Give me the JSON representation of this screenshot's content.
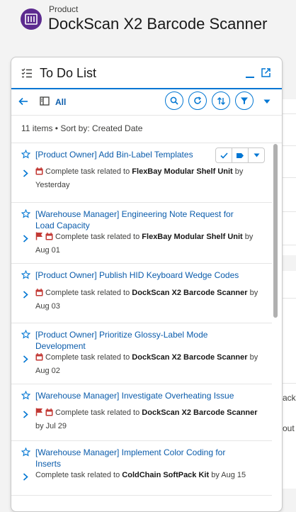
{
  "header": {
    "object_label": "Product",
    "record_title": "DockScan X2 Barcode Scanner"
  },
  "background": {
    "snippets": [
      "ack,",
      "out"
    ]
  },
  "panel": {
    "title": "To Do List",
    "list_view": "All",
    "count_sort": "11 items • Sort by: Created Date"
  },
  "tasks": [
    {
      "title": "[Product Owner] Add Bin-Label Templates",
      "prefix": "Complete task related to ",
      "related": "FlexBay Modular Shelf Unit",
      "due": " by Yesterday",
      "icons": [
        "calendar"
      ]
    },
    {
      "title": "[Warehouse Manager] Engineering Note Request for Load Capacity",
      "prefix": "Complete task related to ",
      "related": "FlexBay Modular Shelf Unit",
      "due": " by Aug 01",
      "icons": [
        "flag",
        "calendar"
      ]
    },
    {
      "title": "[Product Owner] Publish HID Keyboard Wedge Codes",
      "prefix": "Complete task related to ",
      "related": "DockScan X2 Barcode Scanner",
      "due": " by Aug 03",
      "icons": [
        "calendar"
      ]
    },
    {
      "title": "[Product Owner] Prioritize Glossy-Label Mode Development",
      "prefix": "Complete task related to ",
      "related": "DockScan X2 Barcode Scanner",
      "due": " by Aug 02",
      "icons": [
        "calendar"
      ]
    },
    {
      "title": "[Warehouse Manager] Investigate Overheating Issue",
      "prefix": "Complete task related to ",
      "related": "DockScan X2 Barcode Scanner",
      "due": " by Jul 29",
      "icons": [
        "flag",
        "calendar"
      ]
    },
    {
      "title": "[Warehouse Manager] Implement Color Coding for Inserts",
      "prefix": "Complete task related to ",
      "related": "ColdChain SoftPack Kit",
      "due": " by Aug 15",
      "icons": []
    }
  ],
  "colors": {
    "accent": "#0176d3",
    "link": "#0b5cab",
    "flag": "#c23934",
    "calendar": "#c23934",
    "object_icon": "#5c2a8f"
  },
  "scroll_position": 0
}
